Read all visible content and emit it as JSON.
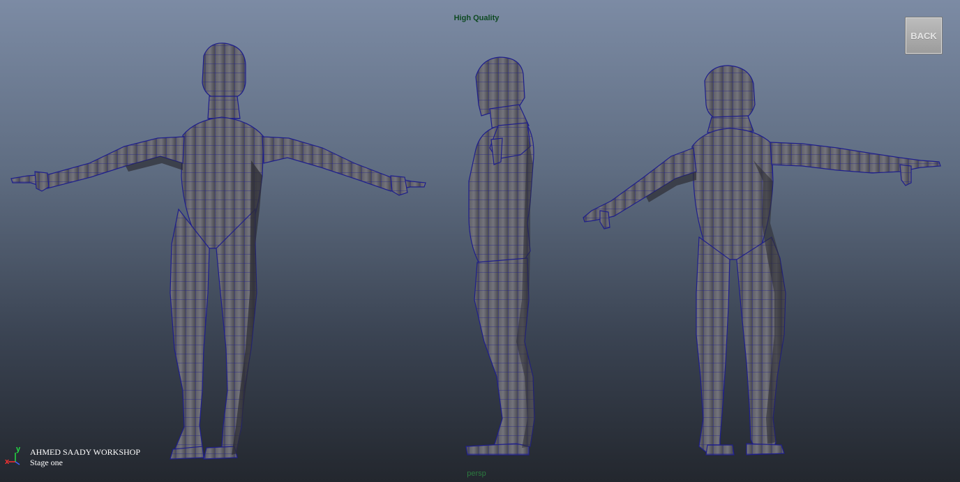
{
  "viewport": {
    "quality_label": "High Quality",
    "back_label": "BACK",
    "camera_label": "persp"
  },
  "credits": {
    "title": "AHMED SAADY WORKSHOP",
    "stage": "Stage one"
  },
  "axes": {
    "x": "x",
    "y": "y"
  },
  "colors": {
    "mesh_fill": "#6a6a70",
    "mesh_shadow": "#2e2e34",
    "wireframe": "#1e1e8c",
    "quality_text": "#0e4a22",
    "camera_text": "#2c7a3f"
  }
}
